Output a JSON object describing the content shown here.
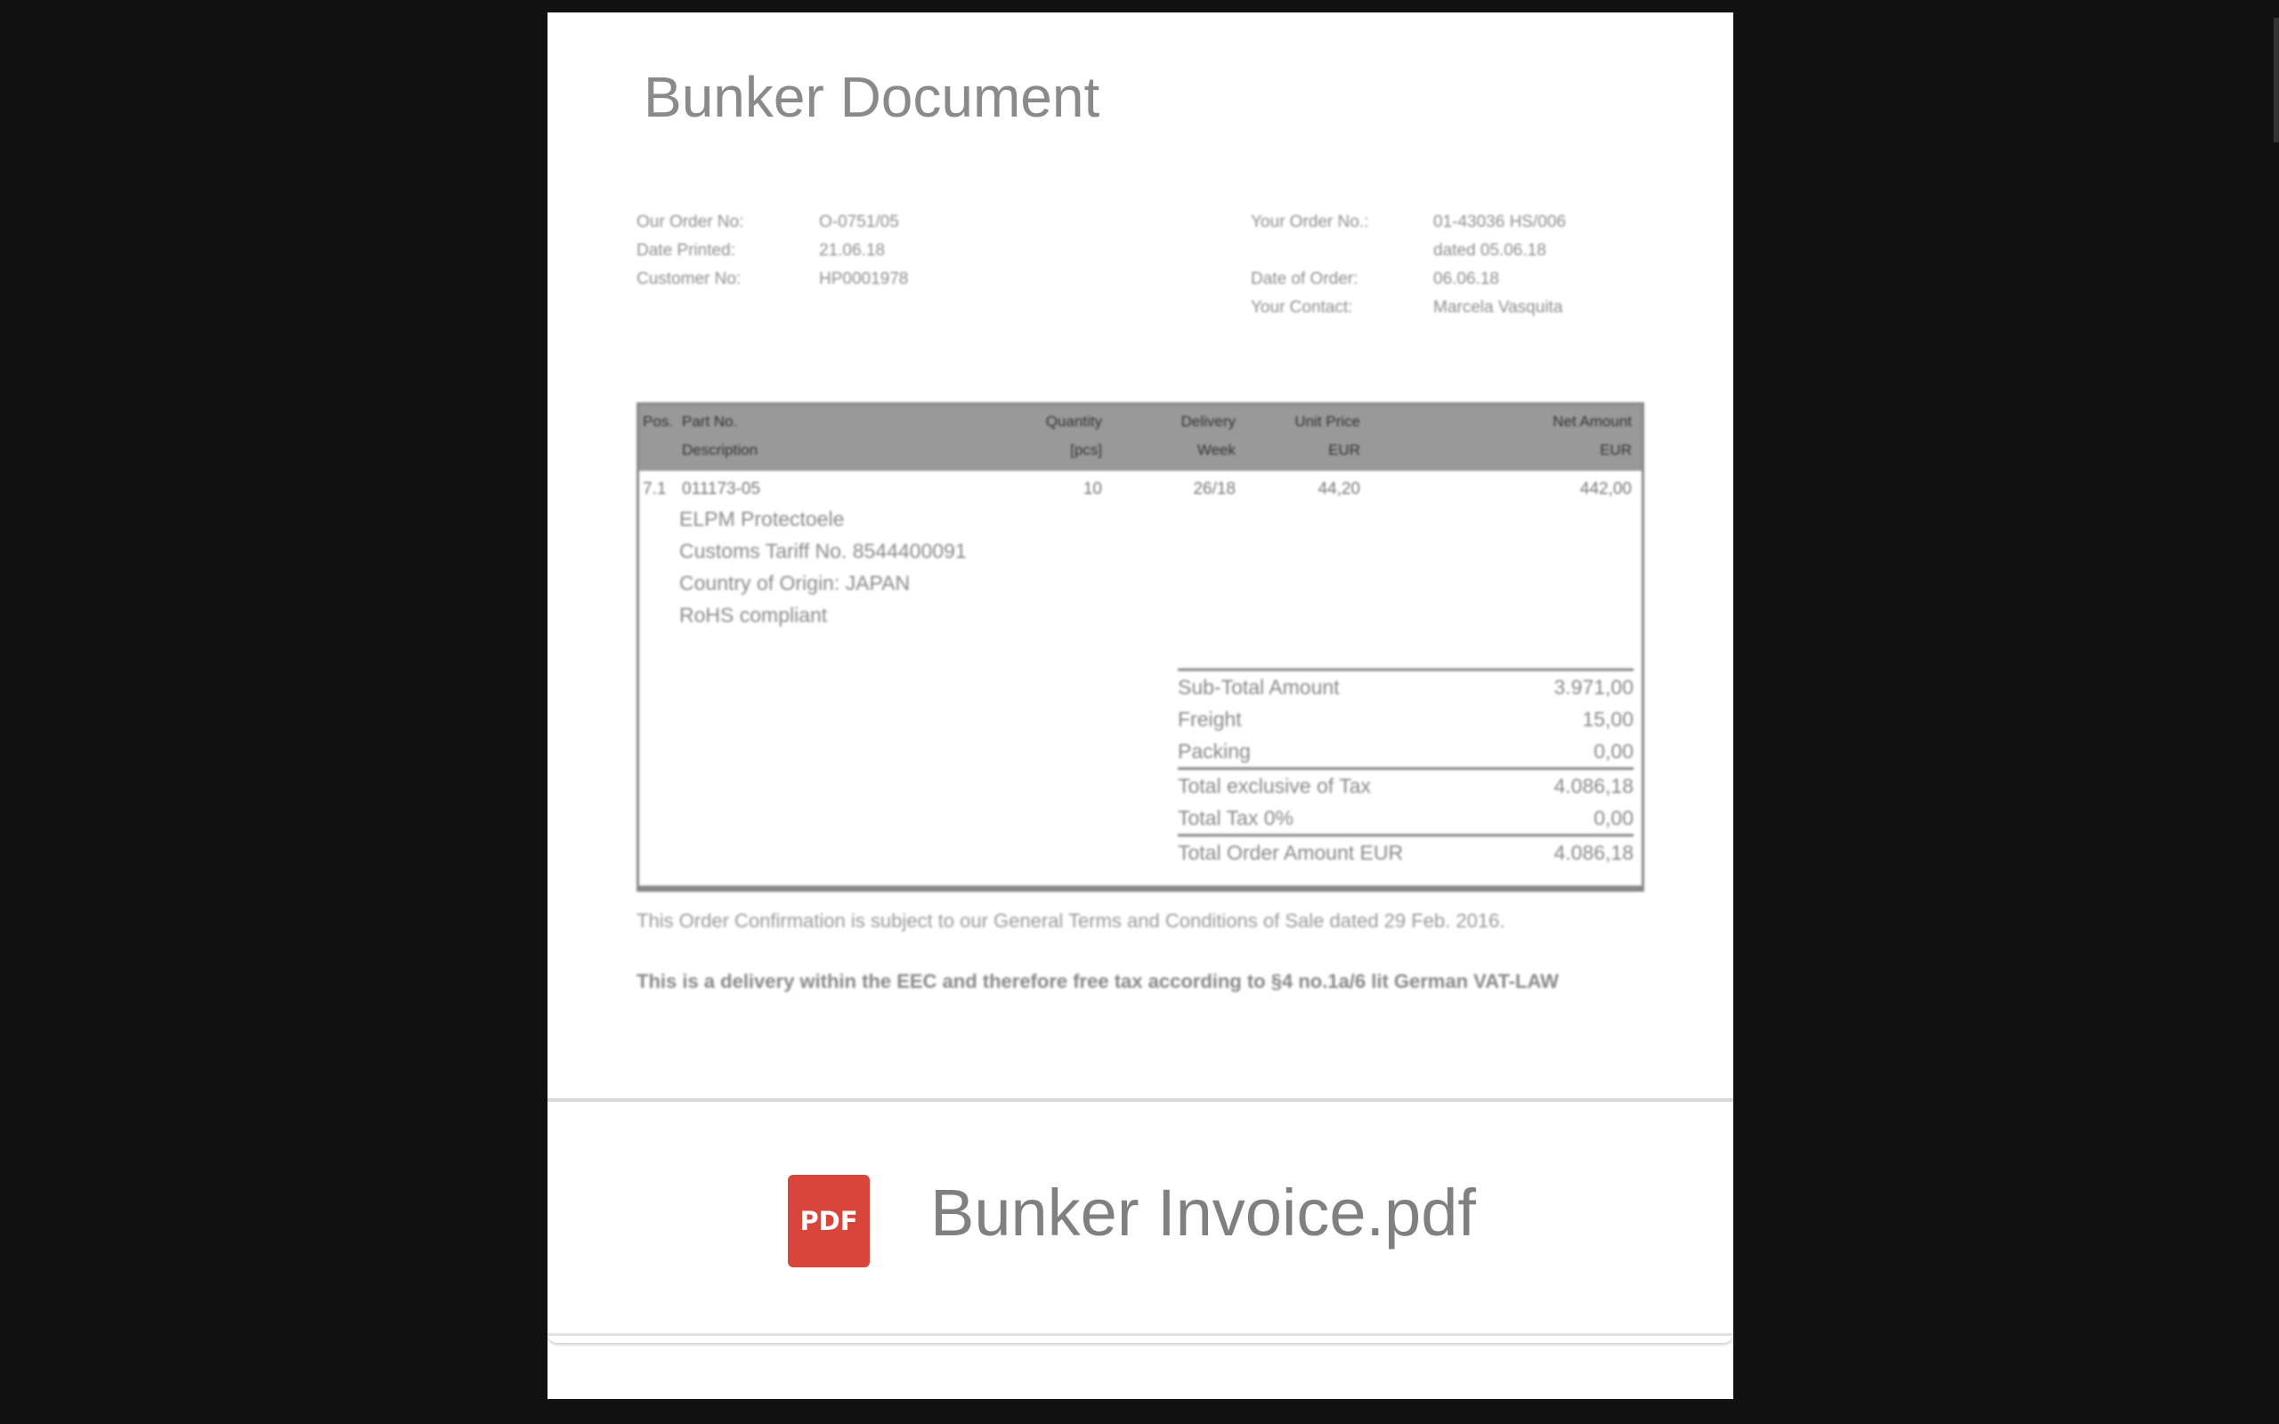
{
  "card": {
    "title": "Bunker Document"
  },
  "document": {
    "meta_left": [
      {
        "label": "Our Order No:",
        "value": "O-0751/05"
      },
      {
        "label": "Date Printed:",
        "value": "21.06.18"
      },
      {
        "label": "Customer No:",
        "value": "HP0001978"
      }
    ],
    "meta_right": [
      {
        "label": "Your Order No.:",
        "value": "01-43036 HS/006"
      },
      {
        "label": "",
        "value": "dated 05.06.18"
      },
      {
        "label": "Date of Order:",
        "value": "06.06.18"
      },
      {
        "label": "Your Contact:",
        "value": "Marcela Vasquita"
      }
    ],
    "table": {
      "headers": {
        "pos": "Pos.",
        "part_no": "Part No.",
        "description": "Description",
        "quantity": "Quantity",
        "quantity_unit": "[pcs]",
        "delivery": "Delivery",
        "delivery_sub": "Week",
        "unit_price": "Unit Price",
        "unit_price_cur": "EUR",
        "net_amount": "Net Amount",
        "net_amount_cur": "EUR"
      },
      "row": {
        "pos": "7.1",
        "part_no": "011173-05",
        "quantity": "10",
        "delivery": "26/18",
        "unit_price": "44,20",
        "net_amount": "442,00"
      },
      "description_lines": [
        "ELPM Protectoele",
        "Customs Tariff No. 8544400091",
        "Country of Origin: JAPAN",
        "RoHS compliant"
      ],
      "totals": [
        {
          "label": "Sub-Total Amount",
          "value": "3.971,00"
        },
        {
          "label": "Freight",
          "value": "15,00"
        },
        {
          "label": "Packing",
          "value": "0,00"
        },
        {
          "label": "Total exclusive of Tax",
          "value": "4.086,18"
        },
        {
          "label": "Total Tax 0%",
          "value": "0,00"
        },
        {
          "label": "Total Order Amount EUR",
          "value": "4.086,18"
        }
      ]
    },
    "note_1": "This Order Confirmation is subject to our General Terms and Conditions of Sale dated 29 Feb. 2016.",
    "note_2": "This is a delivery within the EEC and therefore free tax according to §4 no.1a/6 lit German VAT-LAW"
  },
  "attachment": {
    "icon_label": "PDF",
    "icon_color": "#d9453a",
    "file_name": "Bunker Invoice.pdf"
  }
}
